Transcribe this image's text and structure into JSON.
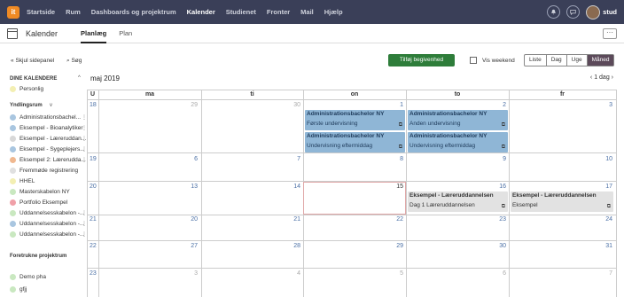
{
  "topnav": {
    "logo": "it",
    "items": [
      "Startside",
      "Rum",
      "Dashboards og projektrum",
      "Kalender",
      "Studienet",
      "Fronter",
      "Mail",
      "Hjælp"
    ],
    "user": "stud"
  },
  "header": {
    "title": "Kalender",
    "tabs": [
      "Planlæg",
      "Plan"
    ],
    "more": "···"
  },
  "toolbar": {
    "hide_panel": "Skjul sidepanel",
    "search": "Søg",
    "add_event": "Tilføj begivenhed",
    "weekend": "Vis weekend",
    "views": [
      "Liste",
      "Dag",
      "Uge",
      "Måned"
    ]
  },
  "sidebar": {
    "section1": "DINE KALENDERE",
    "personal": "Personlig",
    "section2": "Yndlingsrum",
    "rooms": [
      {
        "label": "Administrationsbachel...",
        "color": "#a9c6e0"
      },
      {
        "label": "Eksempel - Bioanalytiker",
        "color": "#a9c6e0"
      },
      {
        "label": "Eksempel - Læreruddan...",
        "color": "#d8d8d8"
      },
      {
        "label": "Eksempel - Sygeplejers...",
        "color": "#a9c6e0"
      },
      {
        "label": "Eksempel 2: Læreruddа...",
        "color": "#f0b890"
      },
      {
        "label": "Fremmøde registrering",
        "color": "#e0e0e0"
      },
      {
        "label": "HHEL",
        "color": "#f3efb3"
      },
      {
        "label": "Masterskabelon NY",
        "color": "#c9e8c0"
      },
      {
        "label": "Portfolio Eksempel",
        "color": "#f0a0a8"
      },
      {
        "label": "Uddannelsesskabelon -...",
        "color": "#c9e8c0"
      },
      {
        "label": "Uddannelsesskabelon -...",
        "color": "#a9c6e0"
      },
      {
        "label": "Uddannelsesskabelon -...",
        "color": "#c9e8c0"
      }
    ],
    "section3": "Foretrukne projektrum",
    "projects": [
      {
        "label": "Demo pha",
        "color": "#c9e8c0"
      },
      {
        "label": "gfjj",
        "color": "#c9e8c0"
      }
    ]
  },
  "calendar": {
    "title": "maj 2019",
    "nav": "‹  1 dag  ›",
    "week_label": "U",
    "days": [
      "ma",
      "ti",
      "on",
      "to",
      "fr"
    ],
    "weeks": [
      "18",
      "19",
      "20",
      "21",
      "22",
      "23"
    ],
    "dates": [
      [
        "29",
        "30",
        "1",
        "2",
        "3"
      ],
      [
        "6",
        "7",
        "8",
        "9",
        "10"
      ],
      [
        "13",
        "14",
        "15",
        "16",
        "17"
      ],
      [
        "20",
        "21",
        "22",
        "23",
        "24"
      ],
      [
        "27",
        "28",
        "29",
        "30",
        "31"
      ],
      [
        "3",
        "4",
        "5",
        "6",
        "7"
      ]
    ],
    "events": {
      "e1": {
        "title": "Administrationsbachelor NY",
        "sub": "Første undervisning"
      },
      "e2": {
        "title": "Administrationsbachelor NY",
        "sub": "Undervisning eftermiddag"
      },
      "e3": {
        "title": "Administrationsbachelor NY",
        "sub": "Anden undervisning"
      },
      "e4": {
        "title": "Administrationsbachelor NY",
        "sub": "Undervisning eftermiddag"
      },
      "e5": {
        "title": "Eksempel - Læreruddannelsen",
        "sub": "Dag 1 Læreruddannelsen"
      },
      "e6": {
        "title": "Eksempel - Læreruddannelsen",
        "sub": "Eksempel"
      }
    }
  }
}
